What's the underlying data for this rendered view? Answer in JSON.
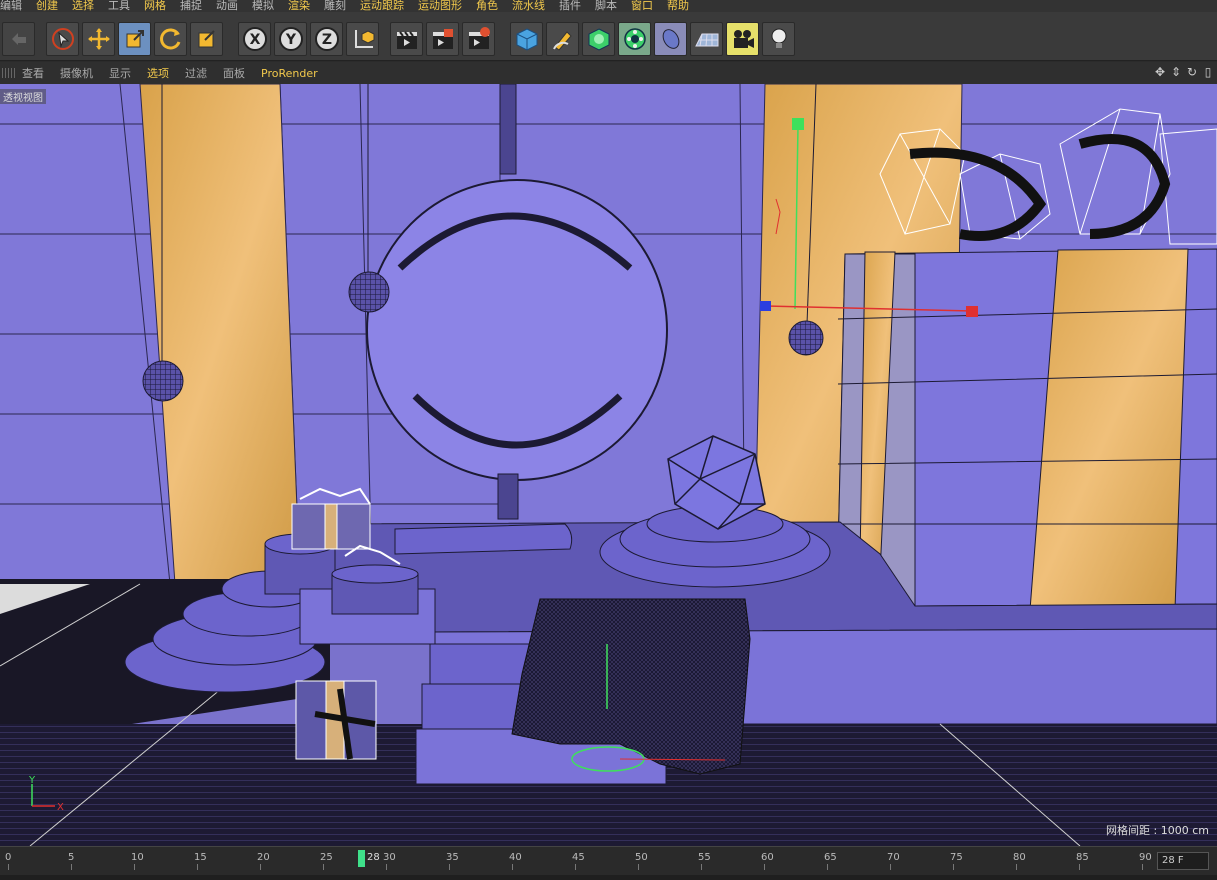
{
  "menu": {
    "items": [
      "编辑",
      "创建",
      "选择",
      "工具",
      "网格",
      "捕捉",
      "动画",
      "模拟",
      "渲染",
      "雕刻",
      "运动跟踪",
      "运动图形",
      "角色",
      "流水线",
      "插件",
      "脚本",
      "窗口",
      "帮助"
    ]
  },
  "toolbar": {
    "axis_x": "X",
    "axis_y": "Y",
    "axis_z": "Z",
    "accent_color": "#6c90c0"
  },
  "view_menu": {
    "items": [
      "查看",
      "摄像机",
      "显示",
      "选项",
      "过滤",
      "面板",
      "ProRender"
    ]
  },
  "viewport": {
    "label": "透视视图",
    "grid_spacing": "网格间距 : 1000 cm",
    "axis_y": "Y",
    "axis_x": "X"
  },
  "timeline": {
    "ticks": [
      "0",
      "5",
      "10",
      "15",
      "20",
      "25",
      "30",
      "35",
      "40",
      "45",
      "50",
      "55",
      "60",
      "65",
      "70",
      "75",
      "80",
      "85",
      "90"
    ],
    "current_frame_label": "28",
    "frame_field": "28 F"
  }
}
